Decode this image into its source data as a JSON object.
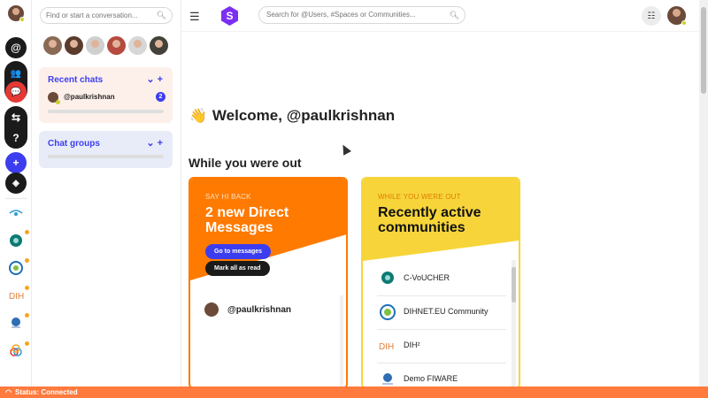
{
  "rail": {
    "buttons": [
      {
        "icon": "at-icon",
        "glyph": "@"
      },
      {
        "icon": "people-icon",
        "glyph": "👥"
      },
      {
        "icon": "chat-bubbles-icon",
        "glyph": "💬"
      },
      {
        "icon": "swap-arrows-icon",
        "glyph": "⇆"
      },
      {
        "icon": "help-icon",
        "glyph": "?"
      },
      {
        "icon": "plus-icon",
        "glyph": "+"
      },
      {
        "icon": "compass-icon",
        "glyph": "◈"
      }
    ],
    "communities": [
      {
        "icon": "community-logo-1-icon"
      },
      {
        "icon": "community-logo-cvoucher-icon"
      },
      {
        "icon": "community-logo-dihnet-icon"
      },
      {
        "icon": "community-logo-dih-icon"
      },
      {
        "icon": "community-logo-fiware-icon"
      },
      {
        "icon": "community-logo-6-icon"
      }
    ],
    "accent_red": "#e53935",
    "accent_blue": "#3d3df0"
  },
  "sidebar": {
    "find_placeholder": "Find or start a conversation...",
    "recent_chats_title": "Recent chats",
    "recent_chats": [
      {
        "name": "@paulkrishnan",
        "unread": "2"
      }
    ],
    "chat_groups_title": "Chat groups"
  },
  "header": {
    "search_placeholder": "Search for @Users, #Spaces or Communities...",
    "logo_letter": "S"
  },
  "main": {
    "welcome": "Welcome, @paulkrishnan",
    "welcome_emoji": "👋",
    "section_title": "While you were out",
    "dm_card": {
      "kicker": "SAY HI BACK",
      "title": "2 new Direct Messages",
      "go_button": "Go to messages",
      "mark_button": "Mark all as read",
      "items": [
        {
          "name": "@paulkrishnan"
        }
      ],
      "color": "#ff7a00"
    },
    "communities_card": {
      "kicker": "WHILE YOU WERE OUT",
      "title": "Recently active communities",
      "items": [
        {
          "name": "C-VoUCHER",
          "icon": "cvoucher-logo-icon"
        },
        {
          "name": "DIHNET.EU Community",
          "icon": "dihnet-logo-icon"
        },
        {
          "name": "DIH²",
          "icon": "dih2-logo-icon"
        },
        {
          "name": "Demo FIWARE",
          "icon": "fiware-logo-icon"
        }
      ],
      "color": "#f7d53a"
    }
  },
  "status": {
    "text": "Status: Connected",
    "color": "#ff7a3d"
  }
}
